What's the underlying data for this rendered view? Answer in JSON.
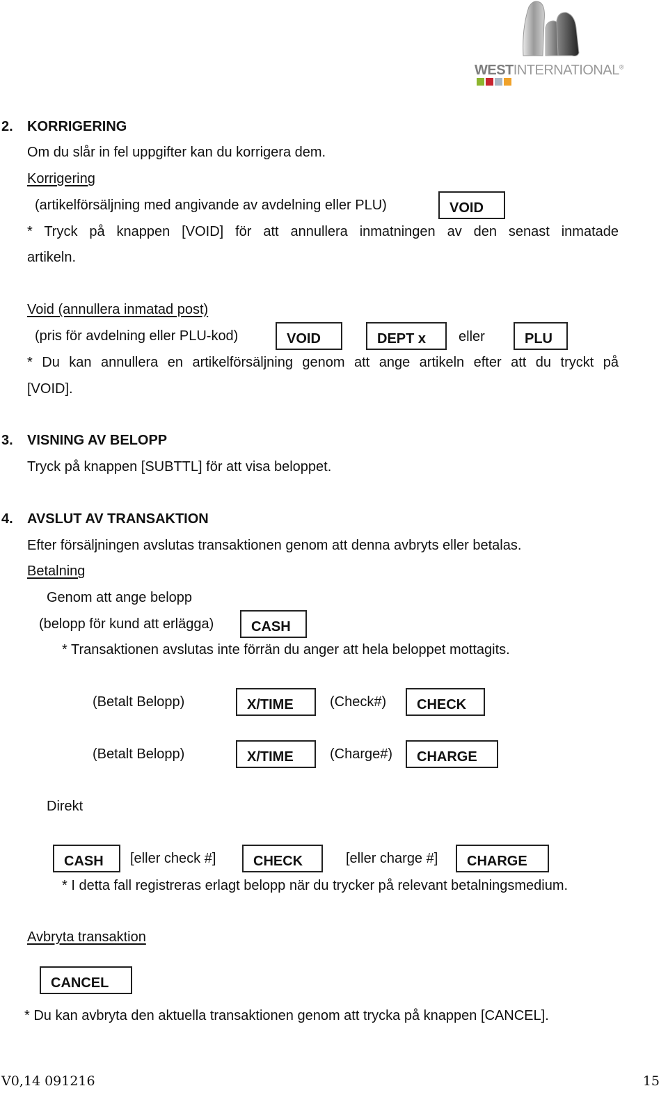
{
  "logo": {
    "brand_bold": "WEST",
    "brand_light": "INTERNATIONAL",
    "registered": "®",
    "icon": "west-international-logo-icon",
    "badge_colors": [
      "#8db52e",
      "#c8242f",
      "#a9b7c4",
      "#f0a22a"
    ]
  },
  "sections": {
    "s2": {
      "number": "2.",
      "title": "KORRIGERING",
      "intro": "Om du slår in fel uppgifter kan du korrigera dem.",
      "sub1": {
        "heading": "Korrigering",
        "input_label": "(artikelförsäljning med angivande av avdelning eller PLU)",
        "key": "VOID",
        "note_line1": "* Tryck på knappen [VOID] för att annullera inmatningen av den senast inmatade",
        "note_line2": "artikeln."
      },
      "sub2": {
        "heading": "Void (annullera inmatad post)",
        "input_label": "(pris för avdelning eller PLU-kod)",
        "keys": [
          "VOID",
          "DEPT x",
          "PLU"
        ],
        "connector": "eller",
        "note_line1": "* Du kan annullera en artikelförsäljning genom att ange artikeln efter att du tryckt på",
        "note_line2": "[VOID]."
      }
    },
    "s3": {
      "number": "3.",
      "title": "VISNING AV BELOPP",
      "body": "Tryck på knappen [SUBTTL] för att visa beloppet."
    },
    "s4": {
      "number": "4.",
      "title": "AVSLUT AV TRANSAKTION",
      "body": "Efter försäljningen avslutas transaktionen genom att denna avbryts eller betalas.",
      "payment": {
        "heading": "Betalning",
        "method1": "Genom att ange belopp",
        "amount_label": "(belopp för kund att erlägga)",
        "cash_key": "CASH",
        "note": "* Transaktionen avslutas inte förrän du anger att hela beloppet mottagits.",
        "rows": [
          {
            "label": "(Betalt Belopp)",
            "key1": "X/TIME",
            "ref": "(Check#)",
            "key2": "CHECK"
          },
          {
            "label": "(Betalt Belopp)",
            "key1": "X/TIME",
            "ref": "(Charge#)",
            "key2": "CHARGE"
          }
        ],
        "direct": {
          "label": "Direkt",
          "key_cash": "CASH",
          "or_check": "[eller check #]",
          "key_check": "CHECK",
          "or_charge": "[eller charge #]",
          "key_charge": "CHARGE",
          "note": "* I detta fall registreras erlagt belopp när du trycker på relevant betalningsmedium."
        }
      },
      "cancel": {
        "heading": "Avbryta transaktion",
        "key": "CANCEL",
        "note": "* Du kan avbryta den aktuella transaktionen genom att trycka på knappen [CANCEL]."
      }
    }
  },
  "footer": {
    "version": "V0,14 091216",
    "page_number": "15"
  }
}
